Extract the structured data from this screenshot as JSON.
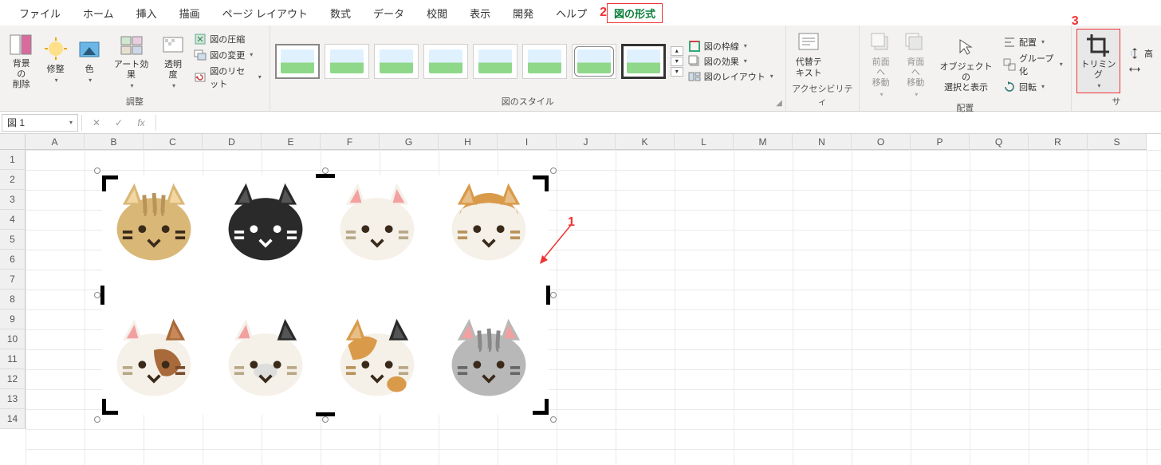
{
  "menu": {
    "items": [
      "ファイル",
      "ホーム",
      "挿入",
      "描画",
      "ページ レイアウト",
      "数式",
      "データ",
      "校閲",
      "表示",
      "開発",
      "ヘルプ",
      "図の形式"
    ],
    "active_index": 11
  },
  "annotations": {
    "a1": "1",
    "a2": "2",
    "a3": "3"
  },
  "ribbon": {
    "group_adjust": "調整",
    "group_styles": "図のスタイル",
    "group_acc": "アクセシビリティ",
    "group_arrange": "配置",
    "group_size": "サ",
    "remove_bg": "背景の\n削除",
    "corrections": "修整",
    "color": "色",
    "artistic": "アート効果",
    "transparency": "透明\n度",
    "compress": "図の圧縮",
    "change": "図の変更",
    "reset": "図のリセット",
    "border": "図の枠線",
    "effects": "図の効果",
    "layout": "図のレイアウト",
    "alt_text": "代替テ\nキスト",
    "bring_fwd": "前面へ\n移動",
    "send_back": "背面へ\n移動",
    "selection": "オブジェクトの\n選択と表示",
    "align": "配置",
    "group": "グループ化",
    "rotate": "回転",
    "crop": "トリミング"
  },
  "formula_bar": {
    "name_box": "図 1",
    "fx": "fx"
  },
  "grid": {
    "cols": [
      "A",
      "B",
      "C",
      "D",
      "E",
      "F",
      "G",
      "H",
      "I",
      "J",
      "K",
      "L",
      "M",
      "N",
      "O",
      "P",
      "Q",
      "R",
      "S"
    ],
    "rows": [
      "1",
      "2",
      "3",
      "4",
      "5",
      "6",
      "7",
      "8",
      "9",
      "10",
      "11",
      "12",
      "13",
      "14"
    ]
  }
}
